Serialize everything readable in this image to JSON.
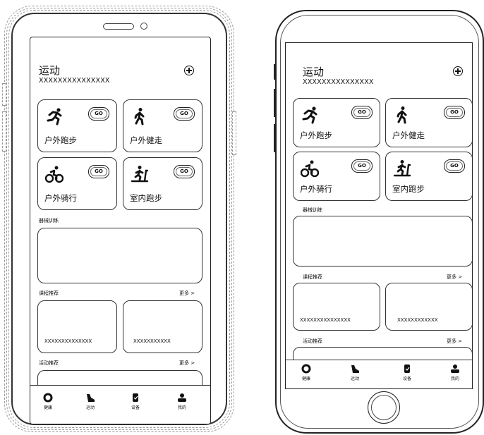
{
  "app": {
    "title": "运动",
    "subtitle": "XXXXXXXXXXXXXXX",
    "activities": [
      {
        "label": "户外跑步",
        "go": "GO",
        "icon": "running-icon"
      },
      {
        "label": "户外健走",
        "go": "GO",
        "icon": "walking-icon"
      },
      {
        "label": "户外骑行",
        "go": "GO",
        "icon": "cycling-icon"
      },
      {
        "label": "室内跑步",
        "go": "GO",
        "icon": "treadmill-icon"
      }
    ],
    "equipment_section": "器械训练",
    "course_section": "课程推荐",
    "activity_section": "活动推荐",
    "more": "更多 >",
    "courses_left": [
      "XXXXXXXXXXXXXX",
      "XXXXXXXXXXX"
    ],
    "courses_right": [
      "XXXXXXXXXXXXXXX",
      "XXXXXXXXXXXX"
    ],
    "tabs": [
      {
        "label": "健康",
        "icon": "health-ring-icon"
      },
      {
        "label": "运动",
        "icon": "shoe-icon"
      },
      {
        "label": "设备",
        "icon": "watch-icon"
      },
      {
        "label": "我的",
        "icon": "person-icon"
      }
    ]
  }
}
